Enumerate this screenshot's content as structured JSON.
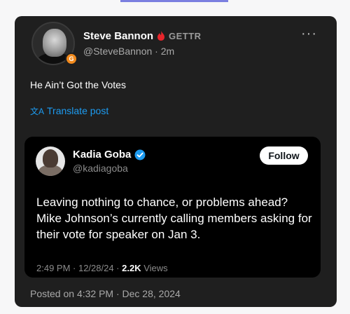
{
  "post": {
    "author_name": "Steve Bannon",
    "platform_label": "GETTR",
    "handle_line": "@SteveBannon · 2m",
    "more_label": "···",
    "text": "He Ain’t Got the Votes",
    "translate_label": "Translate post",
    "posted_label": "Posted on 4:32 PM · Dec 28, 2024"
  },
  "quote": {
    "author_name": "Kadia Goba",
    "handle": "@kadiagoba",
    "follow_label": "Follow",
    "body": "Leaving nothing to chance, or problems ahead? Mike Johnson’s currently calling members asking for their vote for speaker on Jan 3.",
    "timestamp": "2:49 PM · 12/28/24 · ",
    "views_count": "2.2K",
    "views_label": " Views"
  },
  "colors": {
    "card_bg": "#1f1f1f",
    "quote_bg": "#000000",
    "link": "#1d9bf0",
    "verified": "#1d9bf0",
    "gettr_flame": "#e8252b"
  },
  "icons": [
    "gettr-flame-icon",
    "translate-icon",
    "verified-badge-icon",
    "more-options-icon"
  ]
}
